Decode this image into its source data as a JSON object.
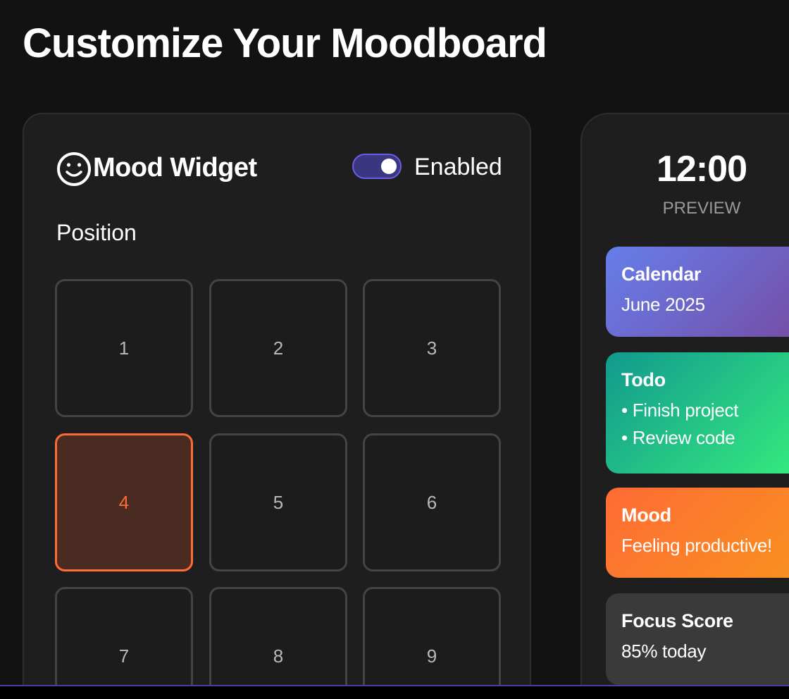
{
  "page": {
    "title": "Customize Your Moodboard"
  },
  "settings": {
    "widget_icon": "smiley-icon",
    "widget_title": "Mood Widget",
    "toggle": {
      "enabled": true,
      "label": "Enabled"
    },
    "position_label": "Position",
    "positions": [
      "1",
      "2",
      "3",
      "4",
      "5",
      "6",
      "7",
      "8",
      "9"
    ],
    "selected_position": "4"
  },
  "preview": {
    "time": "12:00",
    "label": "PREVIEW",
    "widgets": {
      "calendar": {
        "title": "Calendar",
        "lines": [
          "June 2025"
        ]
      },
      "todo": {
        "title": "Todo",
        "lines": [
          "• Finish project",
          "• Review code"
        ]
      },
      "mood": {
        "title": "Mood",
        "lines": [
          "Feeling productive!"
        ]
      },
      "focus": {
        "title": "Focus Score",
        "lines": [
          "85% today"
        ]
      }
    }
  },
  "colors": {
    "background": "#121212",
    "card": "#1e1e1e",
    "accent": "#ff6b35",
    "toggle_accent": "#6c5ce7",
    "calendar_gradient": [
      "#667eea",
      "#764ba2"
    ],
    "todo_gradient": [
      "#11998e",
      "#38ef7d"
    ],
    "mood_gradient": [
      "#ff6b35",
      "#f7931e"
    ],
    "focus_bg": "#3a3a3a"
  }
}
